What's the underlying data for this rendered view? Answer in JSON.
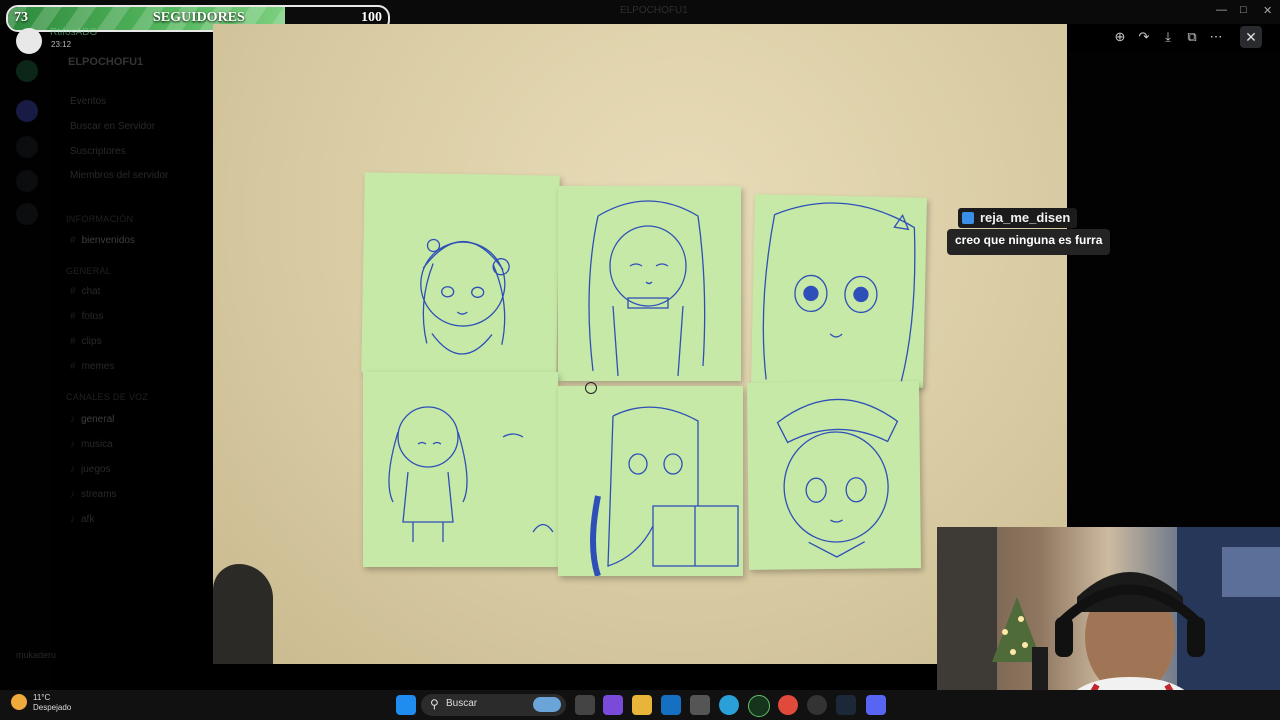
{
  "followers": {
    "current": "73",
    "label": "SEGUIDORES",
    "goal": "100",
    "progress_fraction": 0.73
  },
  "window": {
    "title": "ELPOCHOFU1"
  },
  "post": {
    "author": "RtifosADG",
    "time": "23:12"
  },
  "discord": {
    "server_name": "ELPOCHOFU1",
    "channels": [
      "Eventos",
      "Buscar en Servidor",
      "Suscriptores",
      "Miembros del servidor"
    ],
    "section_1": "INFORMACIÓN",
    "highlight_channel": "bienvenidos",
    "section_2": "GENERAL",
    "text_channels": [
      "chat",
      "fotos",
      "clips",
      "memes"
    ],
    "section_3": "CANALES DE VOZ",
    "voice_channels": [
      "general",
      "musica",
      "juegos",
      "streams",
      "afk"
    ],
    "user": "mukaderu"
  },
  "chat": {
    "username": "reja_me_disen",
    "message": "creo que ninguna es furra"
  },
  "viewer": {
    "tools": [
      "zoom-in-icon",
      "forward-icon",
      "download-icon",
      "open-external-icon",
      "more-icon"
    ]
  },
  "taskbar": {
    "weather_temp": "11°C",
    "weather_desc": "Despejado",
    "search_placeholder": "Buscar"
  },
  "colors": {
    "follower_fill": "#56b85f",
    "note": "#c6e9a7",
    "ink": "#2f4fb8",
    "chat_badge": "#3a8ee6"
  }
}
